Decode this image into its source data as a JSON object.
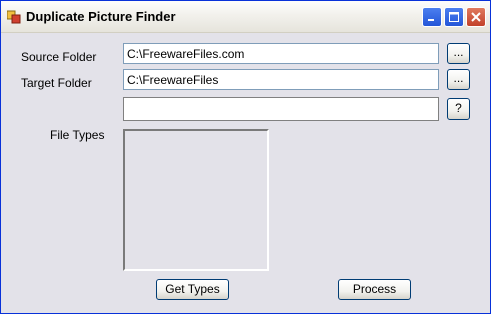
{
  "window": {
    "title": "Duplicate Picture Finder"
  },
  "titlebar_buttons": {
    "minimize": "minimize-icon",
    "maximize": "maximize-icon",
    "close": "close-icon"
  },
  "form": {
    "source_label": "Source Folder",
    "source_value": "C:\\FreewareFiles.com",
    "target_label": "Target Folder",
    "target_value": "C:\\FreewareFiles",
    "extra_value": "",
    "browse_label": "...",
    "help_label": "?",
    "file_types_label": "File Types",
    "get_types_label": "Get Types",
    "process_label": "Process"
  },
  "colors": {
    "accent": "#0831d9",
    "client_bg": "#e3e2e9"
  }
}
